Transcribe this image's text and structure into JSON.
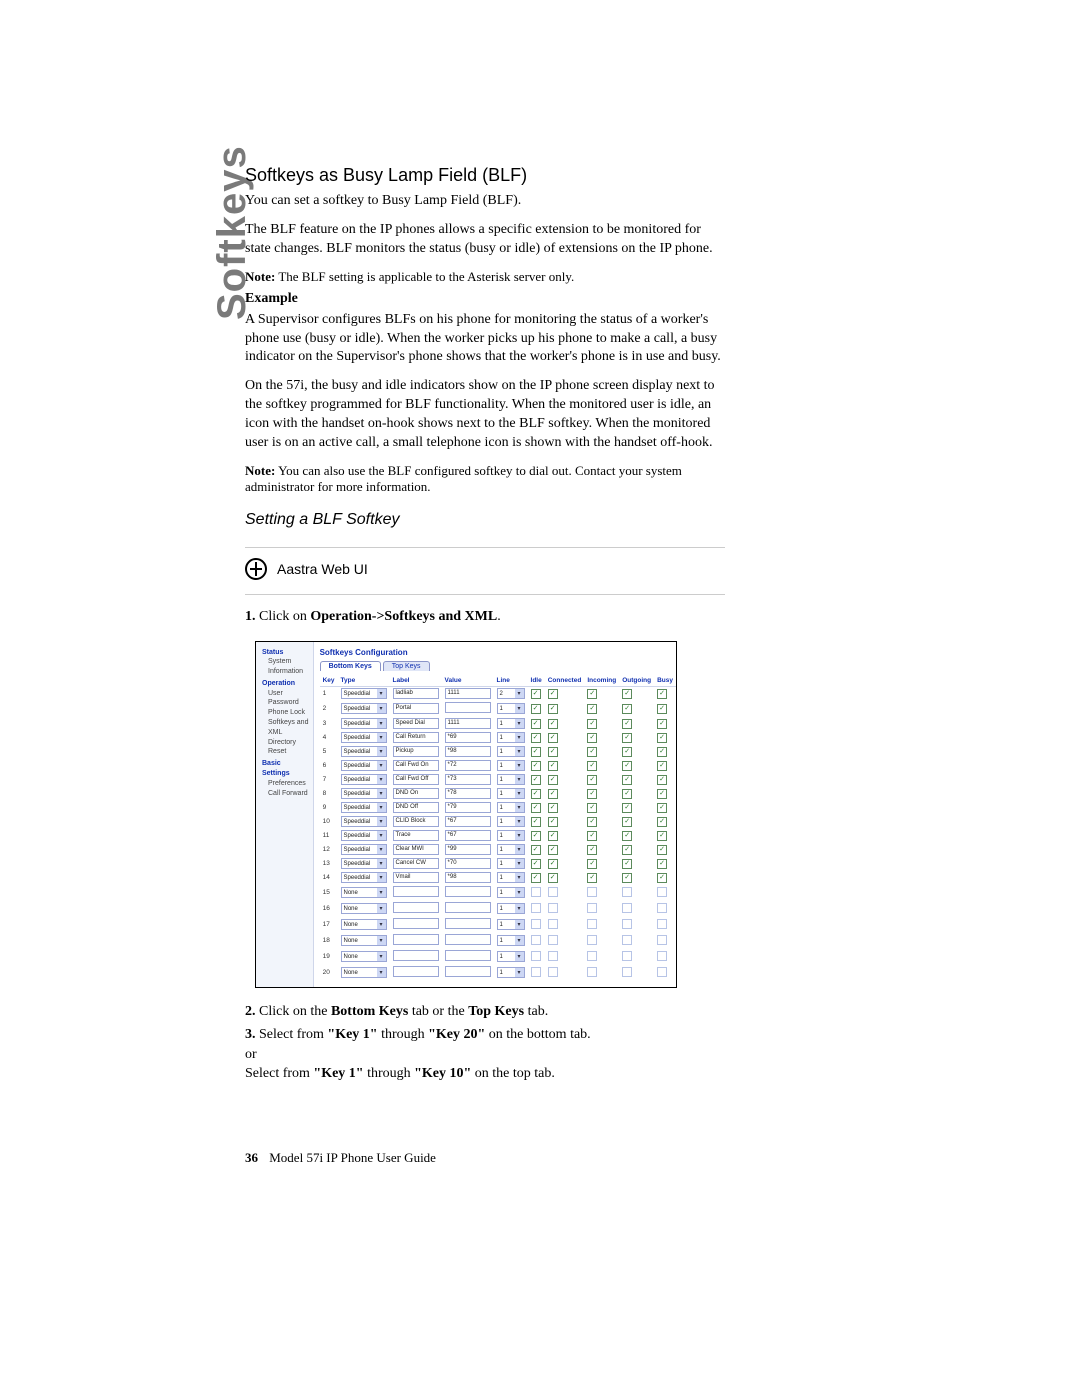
{
  "side_label": "Softkeys",
  "title": "Softkeys as Busy Lamp Field (BLF)",
  "p1": "You can set a softkey to Busy Lamp Field (BLF).",
  "p2": "The BLF feature on the IP phones allows a specific extension to be monitored for state changes. BLF monitors the status (busy or idle) of extensions on the IP phone.",
  "note1_label": "Note:",
  "note1": " The BLF setting is applicable to the Asterisk server only.",
  "example_label": "Example",
  "p3": "A Supervisor configures BLFs on his phone for monitoring the status of a worker's phone use (busy or idle). When the worker picks up his phone to make a call, a busy indicator on the Supervisor's phone shows that the worker's phone is in use and busy.",
  "p4": "On the 57i, the busy and idle indicators show on the IP phone screen display next to the softkey programmed for BLF functionality. When the monitored user is idle, an icon with the handset on-hook shows next to the BLF softkey. When the monitored user is on an active call, a small telephone icon is shown with the handset off-hook.",
  "note2_label": "Note:",
  "note2": " You can also use the BLF configured softkey to dial out. Contact your system administrator for more information.",
  "sub_heading": "Setting a BLF Softkey",
  "webui_label": "Aastra Web UI",
  "step1_a": "Click on ",
  "step1_b": "Operation->Softkeys and XML",
  "step1_c": ".",
  "step2_a": "Click on the ",
  "step2_b": "Bottom Keys",
  "step2_c": " tab or the ",
  "step2_d": "Top Keys",
  "step2_e": " tab.",
  "step3_a": "Select from ",
  "step3_b": "\"Key 1\"",
  "step3_c": " through ",
  "step3_d": "\"Key 20\"",
  "step3_e": " on the bottom tab.",
  "step3_or": "or",
  "step3_f": "Select from ",
  "step3_g": "\"Key 1\"",
  "step3_h": " through ",
  "step3_i": "\"Key 10\"",
  "step3_j": " on the top tab.",
  "footer_page": "36",
  "footer_text": "Model 57i IP Phone User Guide",
  "ui": {
    "nav": {
      "status": "Status",
      "sysinfo": "System Information",
      "operation": "Operation",
      "userpw": "User Password",
      "phonelock": "Phone Lock",
      "softkeys": "Softkeys and XML",
      "directory": "Directory",
      "reset": "Reset",
      "basic": "Basic Settings",
      "prefs": "Preferences",
      "callfwd": "Call Forward"
    },
    "panel_title": "Softkeys Configuration",
    "tab_bottom": "Bottom Keys",
    "tab_top": "Top Keys",
    "cols": {
      "key": "Key",
      "type": "Type",
      "label": "Label",
      "value": "Value",
      "line": "Line",
      "idle": "Idle",
      "connected": "Connected",
      "incoming": "Incoming",
      "outgoing": "Outgoing",
      "busy": "Busy"
    },
    "rows": [
      {
        "key": "1",
        "type": "Speeddial",
        "label": "ladliab",
        "value": "1111",
        "line": "2",
        "active": true
      },
      {
        "key": "2",
        "type": "Speeddial",
        "label": "Portal",
        "value": "",
        "line": "1",
        "active": true
      },
      {
        "key": "3",
        "type": "Speeddial",
        "label": "Speed Dial",
        "value": "1111",
        "line": "1",
        "active": true
      },
      {
        "key": "4",
        "type": "Speeddial",
        "label": "Call Return",
        "value": "*69",
        "line": "1",
        "active": true
      },
      {
        "key": "5",
        "type": "Speeddial",
        "label": "Pickup",
        "value": "*98",
        "line": "1",
        "active": true
      },
      {
        "key": "6",
        "type": "Speeddial",
        "label": "Call Fwd On",
        "value": "*72",
        "line": "1",
        "active": true
      },
      {
        "key": "7",
        "type": "Speeddial",
        "label": "Call Fwd Off",
        "value": "*73",
        "line": "1",
        "active": true
      },
      {
        "key": "8",
        "type": "Speeddial",
        "label": "DND On",
        "value": "*78",
        "line": "1",
        "active": true
      },
      {
        "key": "9",
        "type": "Speeddial",
        "label": "DND Off",
        "value": "*79",
        "line": "1",
        "active": true
      },
      {
        "key": "10",
        "type": "Speeddial",
        "label": "CLID Block",
        "value": "*67",
        "line": "1",
        "active": true
      },
      {
        "key": "11",
        "type": "Speeddial",
        "label": "Trace",
        "value": "*67",
        "line": "1",
        "active": true
      },
      {
        "key": "12",
        "type": "Speeddial",
        "label": "Clear MWI",
        "value": "*99",
        "line": "1",
        "active": true
      },
      {
        "key": "13",
        "type": "Speeddial",
        "label": "Cancel CW",
        "value": "*70",
        "line": "1",
        "active": true
      },
      {
        "key": "14",
        "type": "Speeddial",
        "label": "Vmail",
        "value": "*98",
        "line": "1",
        "active": true
      },
      {
        "key": "15",
        "type": "None",
        "label": "",
        "value": "",
        "line": "1",
        "active": false
      },
      {
        "key": "16",
        "type": "None",
        "label": "",
        "value": "",
        "line": "1",
        "active": false
      },
      {
        "key": "17",
        "type": "None",
        "label": "",
        "value": "",
        "line": "1",
        "active": false
      },
      {
        "key": "18",
        "type": "None",
        "label": "",
        "value": "",
        "line": "1",
        "active": false
      },
      {
        "key": "19",
        "type": "None",
        "label": "",
        "value": "",
        "line": "1",
        "active": false
      },
      {
        "key": "20",
        "type": "None",
        "label": "",
        "value": "",
        "line": "1",
        "active": false
      }
    ]
  }
}
